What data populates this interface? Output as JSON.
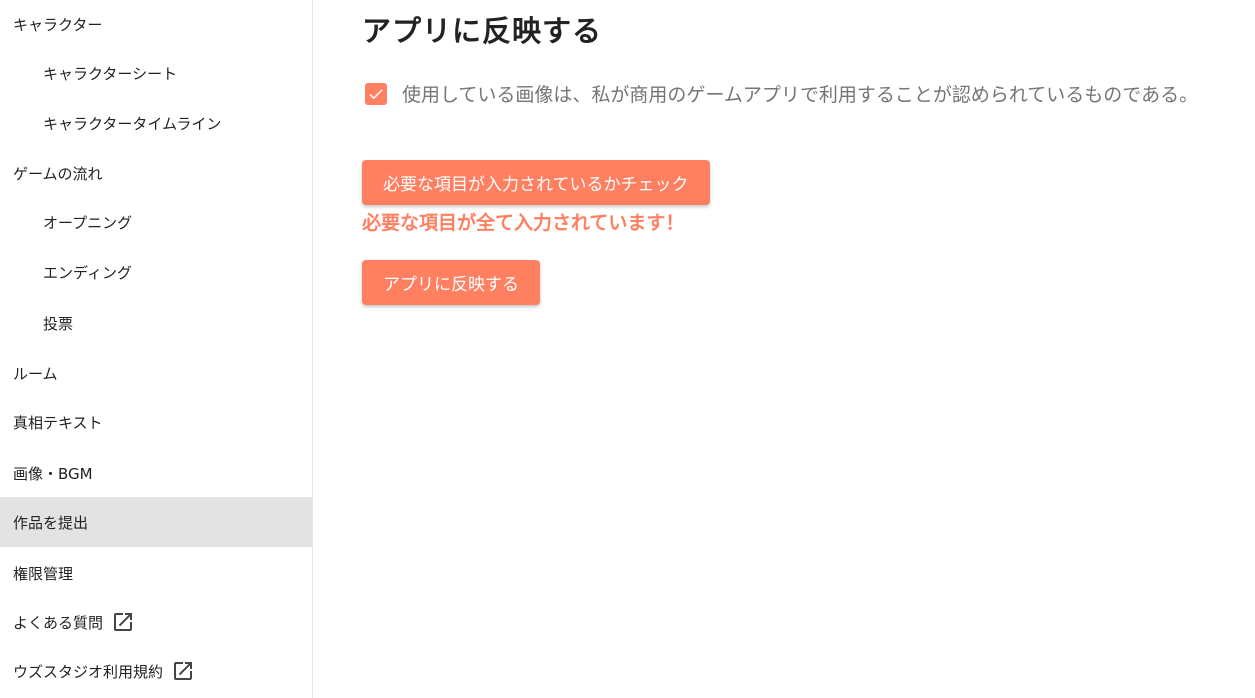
{
  "sidebar": {
    "items": [
      {
        "label": "キャラクター"
      },
      {
        "label": "キャラクターシート"
      },
      {
        "label": "キャラクタータイムライン"
      },
      {
        "label": "ゲームの流れ"
      },
      {
        "label": "オープニング"
      },
      {
        "label": "エンディング"
      },
      {
        "label": "投票"
      },
      {
        "label": "ルーム"
      },
      {
        "label": "真相テキスト"
      },
      {
        "label": "画像・BGM"
      },
      {
        "label": "作品を提出",
        "active": true
      },
      {
        "label": "権限管理"
      },
      {
        "label": "よくある質問",
        "icon": "external-link-icon"
      },
      {
        "label": "ウズスタジオ利用規約",
        "icon": "external-link-icon"
      }
    ]
  },
  "main": {
    "title": "アプリに反映する",
    "consent": {
      "checked": true,
      "label": "使用している画像は、私が商用のゲームアプリで利用することが認められているものである。"
    },
    "check_button_label": "必要な項目が入力されているかチェック",
    "status_message": "必要な項目が全て入力されています！",
    "apply_button_label": "アプリに反映する"
  },
  "colors": {
    "accent": "#ff7f61",
    "active_background": "#e3e3e3",
    "muted_text": "#757575"
  }
}
